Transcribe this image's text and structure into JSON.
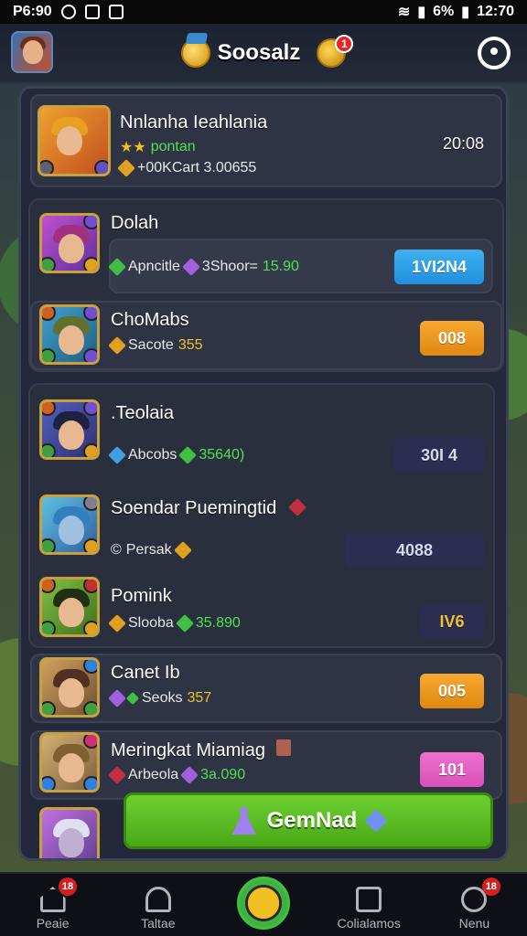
{
  "status_bar": {
    "time": "P6:90",
    "right_time": "12:70",
    "battery": "6%"
  },
  "header": {
    "title": "Soosalz",
    "notif_count": "1"
  },
  "top_card": {
    "name": "Nnlanha Ieahlania",
    "stars": "★★",
    "tag": "pontan",
    "currency": "+00KCart 3.00655",
    "score": "20:08"
  },
  "rows": [
    {
      "name": "Dolah",
      "res_label": "Apncitle",
      "res_extra": "3Shoor=",
      "res_value": "15.90",
      "button": "1VI2N4",
      "button_style": "blue"
    },
    {
      "name": "ChoMabs",
      "res_label": "Sacote",
      "res_value": "355",
      "button": "008",
      "button_style": "orange"
    },
    {
      "name": ".Teolaia",
      "res_label": "Abcobs",
      "res_value": "35640)",
      "button": "30I 4",
      "button_style": "navy"
    },
    {
      "name": "Soendar Puemingtid",
      "res_label": "Persak",
      "res_value": "",
      "button": "4088",
      "button_style": "navy"
    },
    {
      "name": "Pomink",
      "res_label": "Slooba",
      "res_value": "35.890",
      "button": "IV6",
      "button_style": "navy"
    },
    {
      "name": "Canet Ib",
      "res_label": "Seoks",
      "res_value": "357",
      "button": "005",
      "button_style": "orange"
    },
    {
      "name": "Meringkat Miamiag",
      "res_label": "Arbeola",
      "res_value": "3a.090",
      "button": "101",
      "button_style": "pink"
    }
  ],
  "action_button": {
    "label": "GemNad"
  },
  "bottom_nav": [
    {
      "label": "Peaie",
      "badge": "18"
    },
    {
      "label": "Taltae",
      "badge": ""
    },
    {
      "label": "",
      "badge": ""
    },
    {
      "label": "Colialamos",
      "badge": ""
    },
    {
      "label": "Nenu",
      "badge": "18"
    }
  ],
  "colors": {
    "accent_green": "#4aa818",
    "panel": "#23283a",
    "blue_pill": "#2090e0",
    "orange_pill": "#e08810",
    "pink_pill": "#d850b8"
  }
}
